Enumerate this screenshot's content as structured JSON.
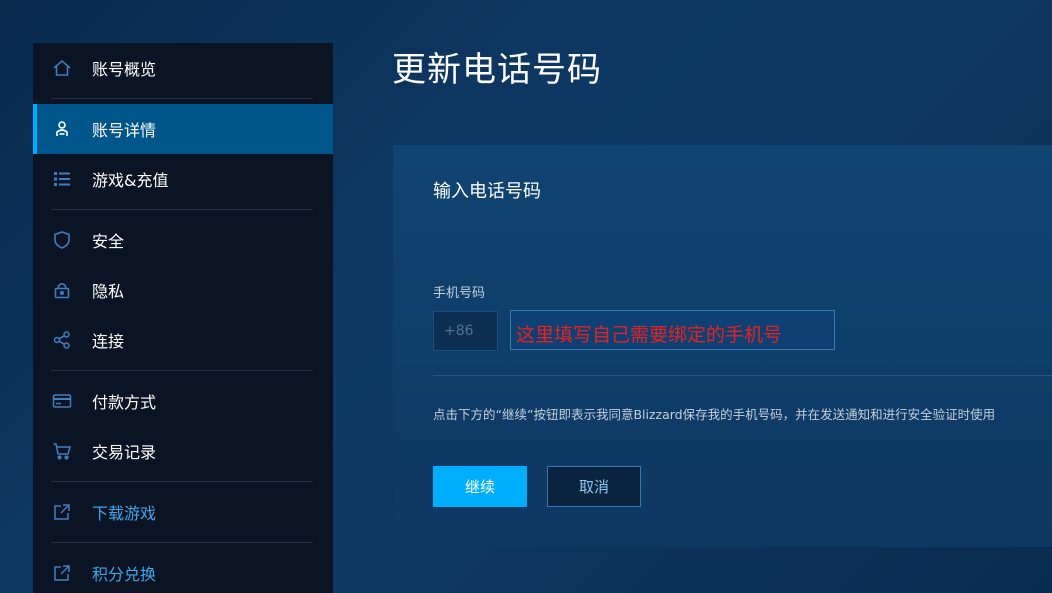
{
  "colors": {
    "accent": "#00aeff",
    "active_nav_bg": "#00568b",
    "link_text": "#3fa6e8",
    "annotation_red": "#e52222",
    "sidebar_bg": "#0a1424"
  },
  "sidebar": {
    "items": [
      {
        "label": "账号概览",
        "icon": "home-icon"
      },
      {
        "label": "账号详情",
        "icon": "user-icon",
        "active": true
      },
      {
        "label": "游戏&充值",
        "icon": "list-icon"
      },
      {
        "label": "安全",
        "icon": "shield-icon"
      },
      {
        "label": "隐私",
        "icon": "lock-icon"
      },
      {
        "label": "连接",
        "icon": "share-icon"
      },
      {
        "label": "付款方式",
        "icon": "credit-card-icon"
      },
      {
        "label": "交易记录",
        "icon": "cart-icon"
      },
      {
        "label": "下载游戏",
        "icon": "external-link-icon"
      },
      {
        "label": "积分兑换",
        "icon": "external-link-icon"
      }
    ]
  },
  "main": {
    "title": "更新电话号码",
    "card": {
      "title": "输入电话号码",
      "field_label": "手机号码",
      "country_code": "+86",
      "annotation": "这里填写自己需要绑定的手机号",
      "consent": "点击下方的“继续”按钮即表示我同意Blizzard保存我的手机号码，并在发送通知和进行安全验证时使用",
      "continue_label": "继续",
      "cancel_label": "取消"
    }
  }
}
